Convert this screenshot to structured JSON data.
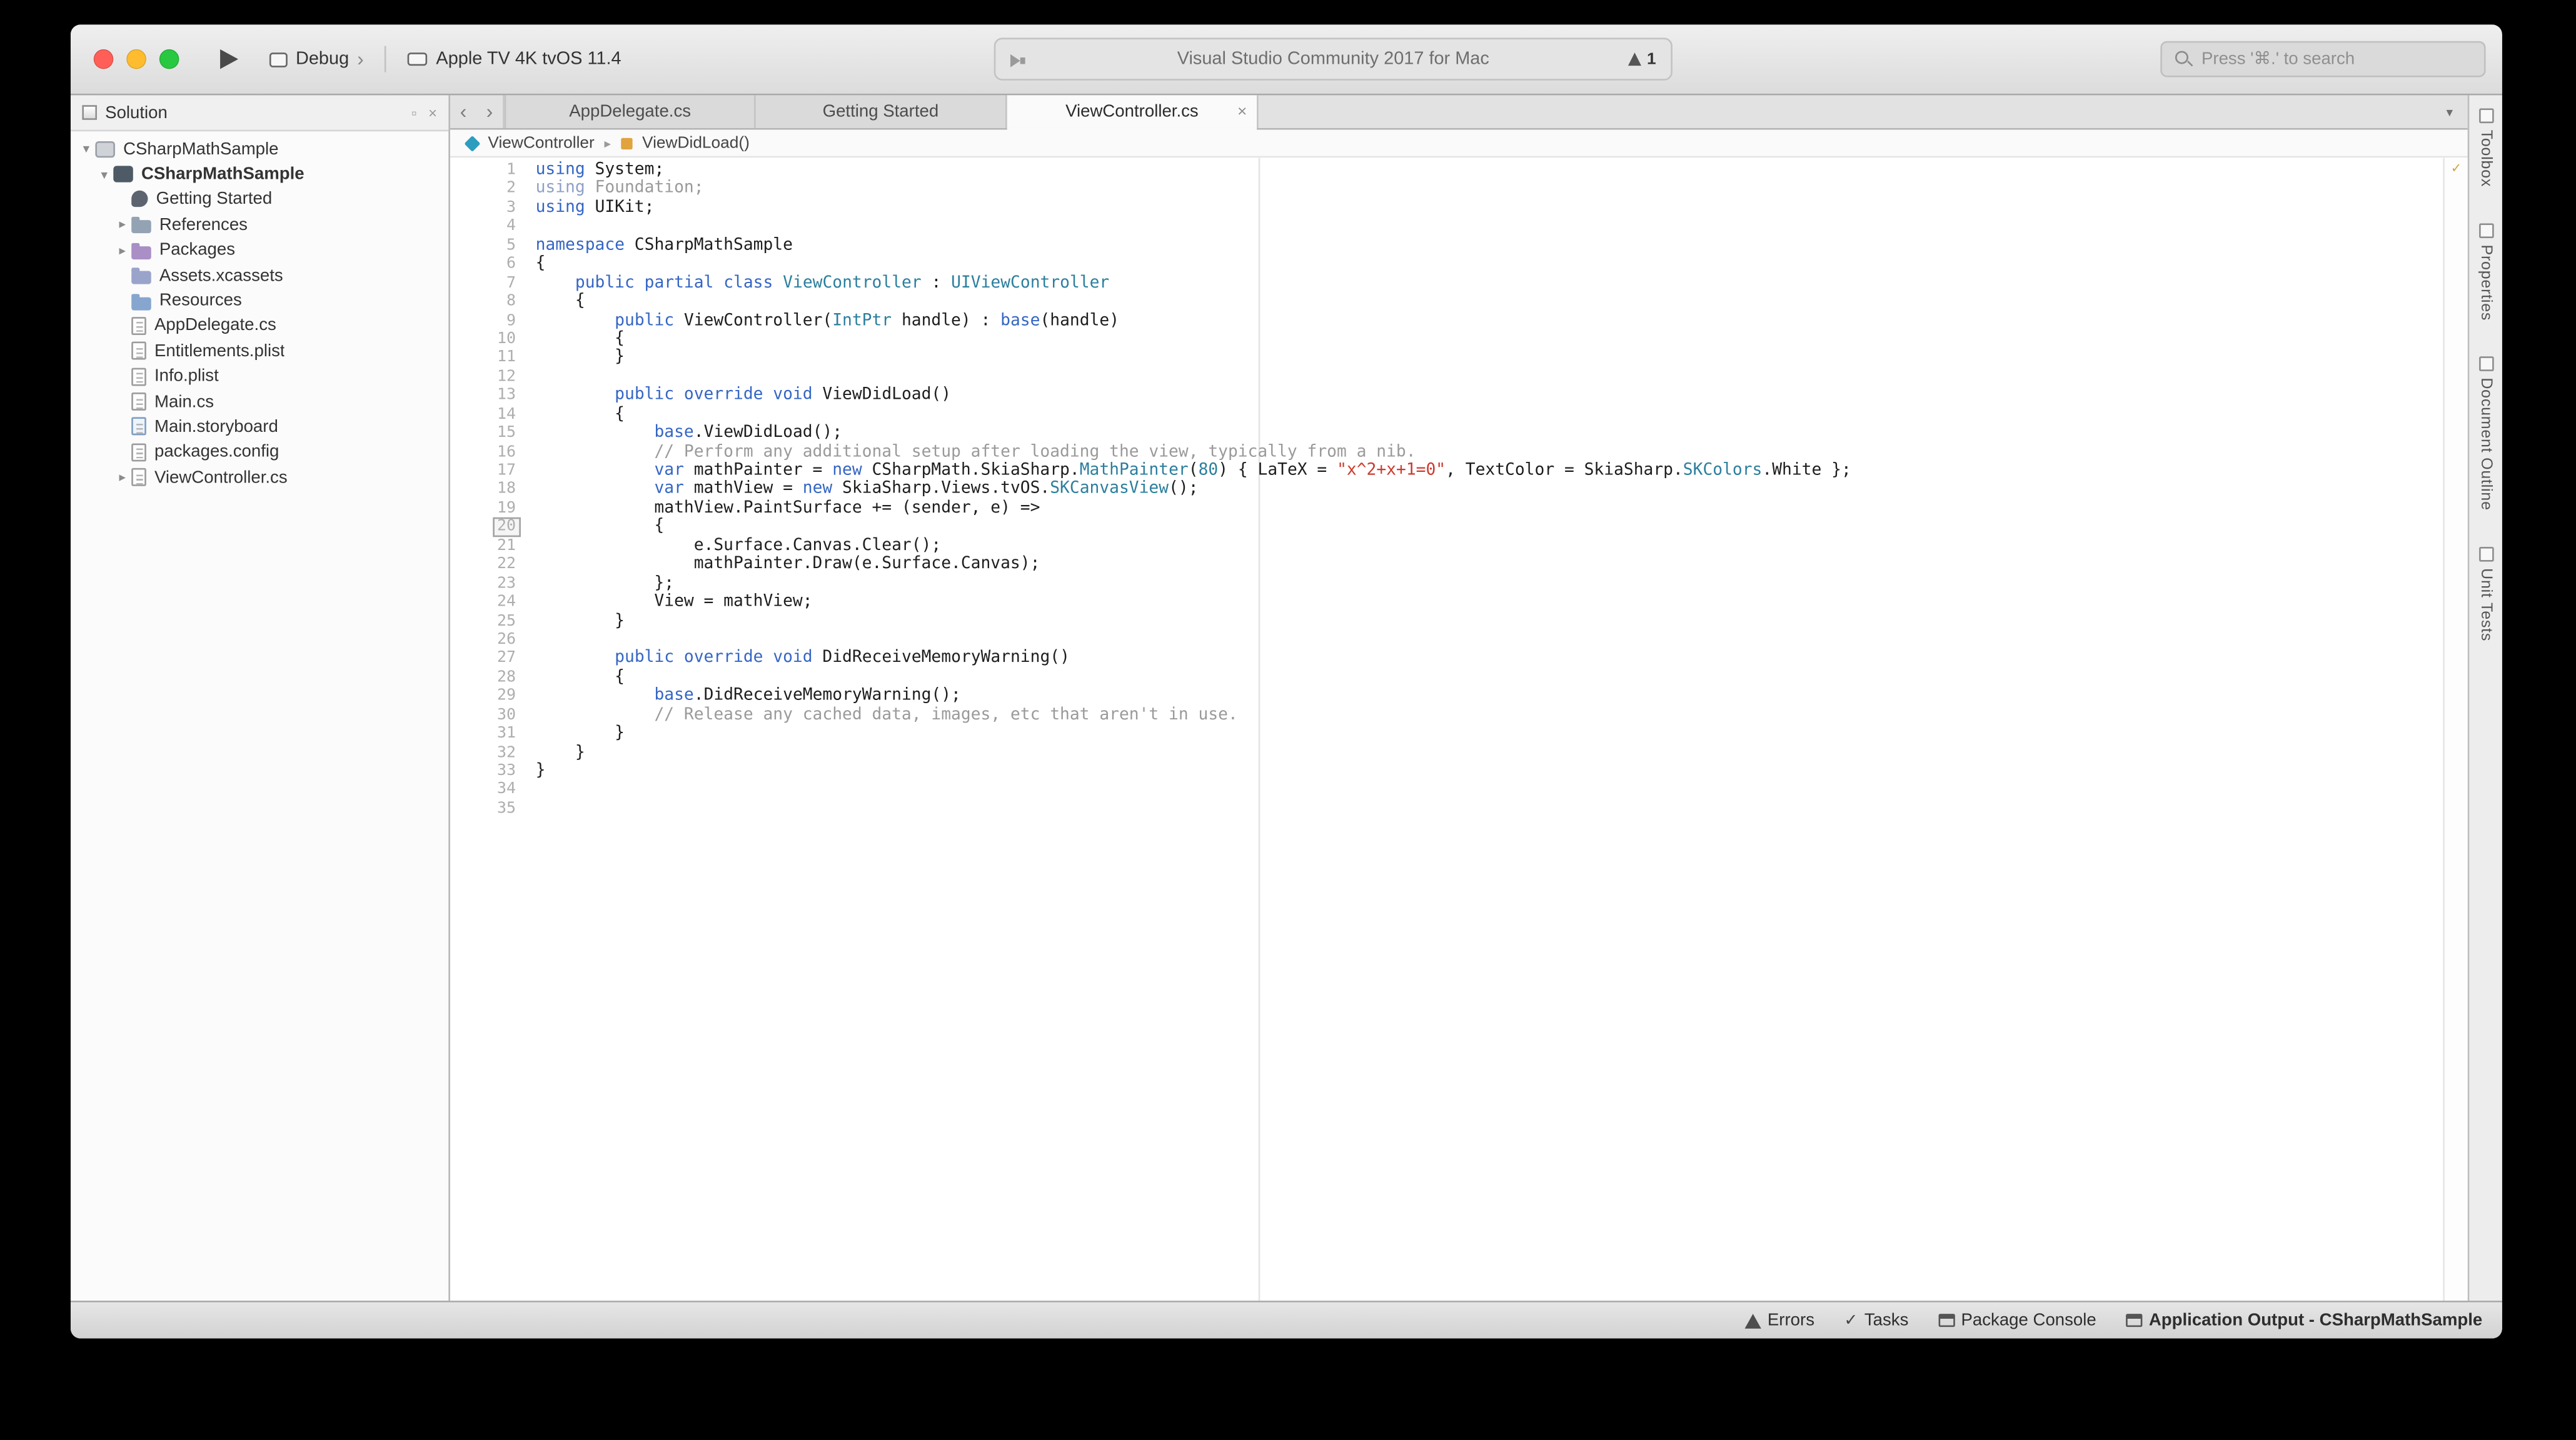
{
  "toolbar": {
    "traffic_lights": [
      {
        "name": "close",
        "color": "#ff5f57"
      },
      {
        "name": "minimize",
        "color": "#febc2e"
      },
      {
        "name": "zoom",
        "color": "#28c840"
      }
    ],
    "config_label": "Debug",
    "config_chevron": "›",
    "device_label": "Apple TV 4K tvOS 11.4",
    "status_text": "Visual Studio Community 2017 for Mac",
    "notification_count": "1",
    "search_placeholder": "Press '⌘.' to search"
  },
  "solution_pad": {
    "title": "Solution",
    "dock_icon": "▫",
    "close_icon": "×",
    "items": [
      {
        "level": 0,
        "disc": "▾",
        "icon": "solution",
        "label": "CSharpMathSample"
      },
      {
        "level": 1,
        "disc": "▾",
        "icon": "project",
        "label": "CSharpMathSample",
        "bold": true
      },
      {
        "level": 2,
        "icon": "getting-started",
        "label": "Getting Started"
      },
      {
        "level": 2,
        "disc": "▸",
        "icon": "folder-references",
        "label": "References"
      },
      {
        "level": 2,
        "disc": "▸",
        "icon": "folder-packages",
        "label": "Packages"
      },
      {
        "level": 2,
        "icon": "folder-assets",
        "label": "Assets.xcassets"
      },
      {
        "level": 2,
        "icon": "folder-resources",
        "label": "Resources"
      },
      {
        "level": 2,
        "icon": "file-cs",
        "label": "AppDelegate.cs"
      },
      {
        "level": 2,
        "icon": "file-plist",
        "label": "Entitlements.plist"
      },
      {
        "level": 2,
        "icon": "file-plist",
        "label": "Info.plist"
      },
      {
        "level": 2,
        "icon": "file-cs",
        "label": "Main.cs"
      },
      {
        "level": 2,
        "icon": "file-storyboard",
        "label": "Main.storyboard"
      },
      {
        "level": 2,
        "icon": "file-config",
        "label": "packages.config"
      },
      {
        "level": 2,
        "disc": "▸",
        "icon": "file-cs",
        "label": "ViewController.cs"
      }
    ]
  },
  "editor_tabs": {
    "back": "‹",
    "forward": "›",
    "overflow": "▾",
    "tabs": [
      {
        "label": "AppDelegate.cs",
        "active": false
      },
      {
        "label": "Getting Started",
        "active": false
      },
      {
        "label": "ViewController.cs",
        "active": true,
        "close_label": "×"
      }
    ]
  },
  "breadcrumb": {
    "class_name": "ViewController",
    "separator": "▸",
    "member_name": "ViewDidLoad()"
  },
  "editor": {
    "current_line": 20,
    "analysis_status": "✓",
    "syntax_colors": {
      "kw": "#3566c4",
      "type": "#2b7f9e",
      "str": "#cc3b2f",
      "cmt": "#9a9a9a",
      "num": "#2b7f9e",
      "plain": "#1e1e1e",
      "dim": "#9a9a9a",
      "dimkw": "#8fa0c8"
    },
    "lines": [
      [
        [
          "k",
          "using"
        ],
        [
          "p",
          " System;"
        ]
      ],
      [
        [
          "dk",
          "using"
        ],
        [
          "d",
          " Foundation;"
        ]
      ],
      [
        [
          "k",
          "using"
        ],
        [
          "p",
          " UIKit;"
        ]
      ],
      [],
      [
        [
          "k",
          "namespace"
        ],
        [
          "p",
          " CSharpMathSample"
        ]
      ],
      [
        [
          "p",
          "{"
        ]
      ],
      [
        [
          "p",
          "    "
        ],
        [
          "k",
          "public partial class"
        ],
        [
          "p",
          " "
        ],
        [
          "t",
          "ViewController"
        ],
        [
          "p",
          " : "
        ],
        [
          "t",
          "UIViewController"
        ]
      ],
      [
        [
          "p",
          "    {"
        ]
      ],
      [
        [
          "p",
          "        "
        ],
        [
          "k",
          "public"
        ],
        [
          "p",
          " ViewController("
        ],
        [
          "t",
          "IntPtr"
        ],
        [
          "p",
          " handle) : "
        ],
        [
          "k",
          "base"
        ],
        [
          "p",
          "(handle)"
        ]
      ],
      [
        [
          "p",
          "        {"
        ]
      ],
      [
        [
          "p",
          "        }"
        ]
      ],
      [],
      [
        [
          "p",
          "        "
        ],
        [
          "k",
          "public override void"
        ],
        [
          "p",
          " ViewDidLoad()"
        ]
      ],
      [
        [
          "p",
          "        {"
        ]
      ],
      [
        [
          "p",
          "            "
        ],
        [
          "k",
          "base"
        ],
        [
          "p",
          ".ViewDidLoad();"
        ]
      ],
      [
        [
          "p",
          "            "
        ],
        [
          "c",
          "// Perform any additional setup after loading the view, typically from a nib."
        ]
      ],
      [
        [
          "p",
          "            "
        ],
        [
          "k",
          "var"
        ],
        [
          "p",
          " mathPainter = "
        ],
        [
          "k",
          "new"
        ],
        [
          "p",
          " CSharpMath.SkiaSharp."
        ],
        [
          "t",
          "MathPainter"
        ],
        [
          "p",
          "("
        ],
        [
          "n",
          "80"
        ],
        [
          "p",
          ") { LaTeX = "
        ],
        [
          "s",
          "\"x^2+x+1=0\""
        ],
        [
          "p",
          ", TextColor = SkiaSharp."
        ],
        [
          "t",
          "SKColors"
        ],
        [
          "p",
          ".White };"
        ]
      ],
      [
        [
          "p",
          "            "
        ],
        [
          "k",
          "var"
        ],
        [
          "p",
          " mathView = "
        ],
        [
          "k",
          "new"
        ],
        [
          "p",
          " SkiaSharp.Views.tvOS."
        ],
        [
          "t",
          "SKCanvasView"
        ],
        [
          "p",
          "();"
        ]
      ],
      [
        [
          "p",
          "            mathView.PaintSurface += (sender, e) =>"
        ]
      ],
      [
        [
          "p",
          "            {"
        ]
      ],
      [
        [
          "p",
          "                e.Surface.Canvas.Clear();"
        ]
      ],
      [
        [
          "p",
          "                mathPainter.Draw(e.Surface.Canvas);"
        ]
      ],
      [
        [
          "p",
          "            };"
        ]
      ],
      [
        [
          "p",
          "            View = mathView;"
        ]
      ],
      [
        [
          "p",
          "        }"
        ]
      ],
      [],
      [
        [
          "p",
          "        "
        ],
        [
          "k",
          "public override void"
        ],
        [
          "p",
          " DidReceiveMemoryWarning()"
        ]
      ],
      [
        [
          "p",
          "        {"
        ]
      ],
      [
        [
          "p",
          "            "
        ],
        [
          "k",
          "base"
        ],
        [
          "p",
          ".DidReceiveMemoryWarning();"
        ]
      ],
      [
        [
          "p",
          "            "
        ],
        [
          "c",
          "// Release any cached data, images, etc that aren't in use."
        ]
      ],
      [
        [
          "p",
          "        }"
        ]
      ],
      [
        [
          "p",
          "    }"
        ]
      ],
      [
        [
          "p",
          "}"
        ]
      ],
      [],
      []
    ]
  },
  "right_panel": {
    "tabs": [
      {
        "icon": "toolbox-icon",
        "label": "Toolbox"
      },
      {
        "icon": "properties-icon",
        "label": "Properties"
      },
      {
        "icon": "document-outline-icon",
        "label": "Document Outline"
      },
      {
        "icon": "unit-tests-icon",
        "label": "Unit Tests"
      }
    ]
  },
  "status_bar": {
    "items": [
      {
        "icon": "warning-icon",
        "label": "Errors"
      },
      {
        "icon": "check-icon",
        "label": "Tasks"
      },
      {
        "icon": "console-icon",
        "label": "Package Console"
      },
      {
        "icon": "console-icon",
        "label": "Application Output - CSharpMathSample",
        "bold": true
      }
    ]
  }
}
